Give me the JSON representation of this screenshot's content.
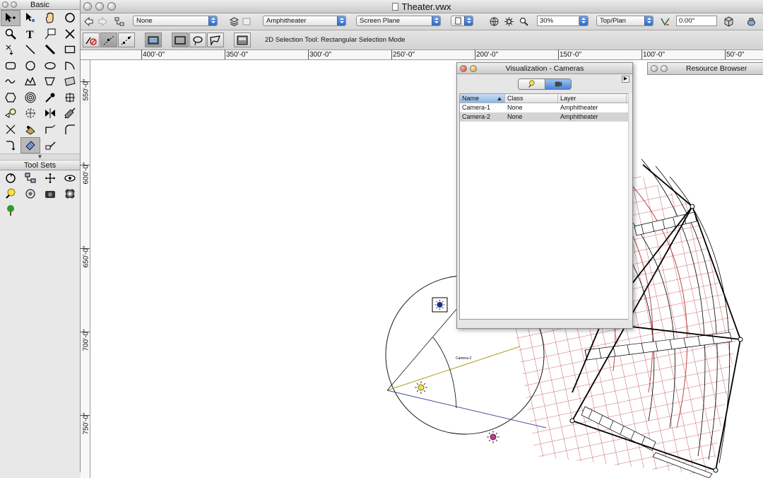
{
  "window": {
    "title": "Theater.vwx"
  },
  "basic_palette": {
    "title": "Basic",
    "tools": [
      "selection-icon",
      "reshape-icon",
      "pan-icon",
      "flyover-icon",
      "zoom-icon",
      "text-icon",
      "callout-icon",
      "dimension-icon",
      "locus-icon",
      "line-icon",
      "wall-icon",
      "rectangle-icon",
      "rounded-rectangle-icon",
      "circle-icon",
      "oval-icon",
      "arc-icon",
      "freehand-icon",
      "polyline-icon",
      "polygon-icon",
      "double-line-icon",
      "regular-polygon-icon",
      "spiral-icon",
      "eyedropper-icon",
      "attribute-mapping-icon",
      "visibility-icon",
      "offset-icon",
      "mirror-icon",
      "split-icon",
      "trim-icon",
      "clip-icon",
      "connect-combine-icon",
      "fillet-icon",
      "move-by-points-icon",
      "eraser-icon",
      "tape-measure-icon"
    ]
  },
  "tool_sets": {
    "title": "Tool Sets",
    "tools": [
      "walkthrough-icon",
      "network-icon",
      "move-view-icon",
      "eye-icon",
      "light-bulb-icon",
      "flashlight-group-icon",
      "camera-icon",
      "crop-icon",
      "tree-icon"
    ]
  },
  "view_bar": {
    "class_value": "None",
    "layer_value": "Amphitheater",
    "plane_value": "Screen Plane",
    "zoom_value": "30%",
    "view_value": "Top/Plan",
    "rotation_value": "0.00°"
  },
  "mode_bar": {
    "help_text": "2D Selection Tool: Rectangular Selection Mode"
  },
  "rulers": {
    "h_labels": [
      "400'-0\"",
      "350'-0\"",
      "300'-0\"",
      "250'-0\"",
      "200'-0\"",
      "150'-0\"",
      "100'-0\"",
      "50'-0\""
    ],
    "v_labels": [
      "550'-0\"",
      "600'-0\"",
      "650'-0\"",
      "700'-0\"",
      "750'-0\""
    ]
  },
  "visualization": {
    "title": "Visualization - Cameras",
    "columns": [
      "Name",
      "Class",
      "Layer"
    ],
    "rows": [
      {
        "name": "Camera-1",
        "class": "None",
        "layer": "Amphitheater"
      },
      {
        "name": "Camera-2",
        "class": "None",
        "layer": "Amphitheater"
      }
    ],
    "selected_row": 1
  },
  "resource_browser": {
    "title": "Resource Browser"
  },
  "canvas": {
    "camera_label": "Camera-2"
  }
}
